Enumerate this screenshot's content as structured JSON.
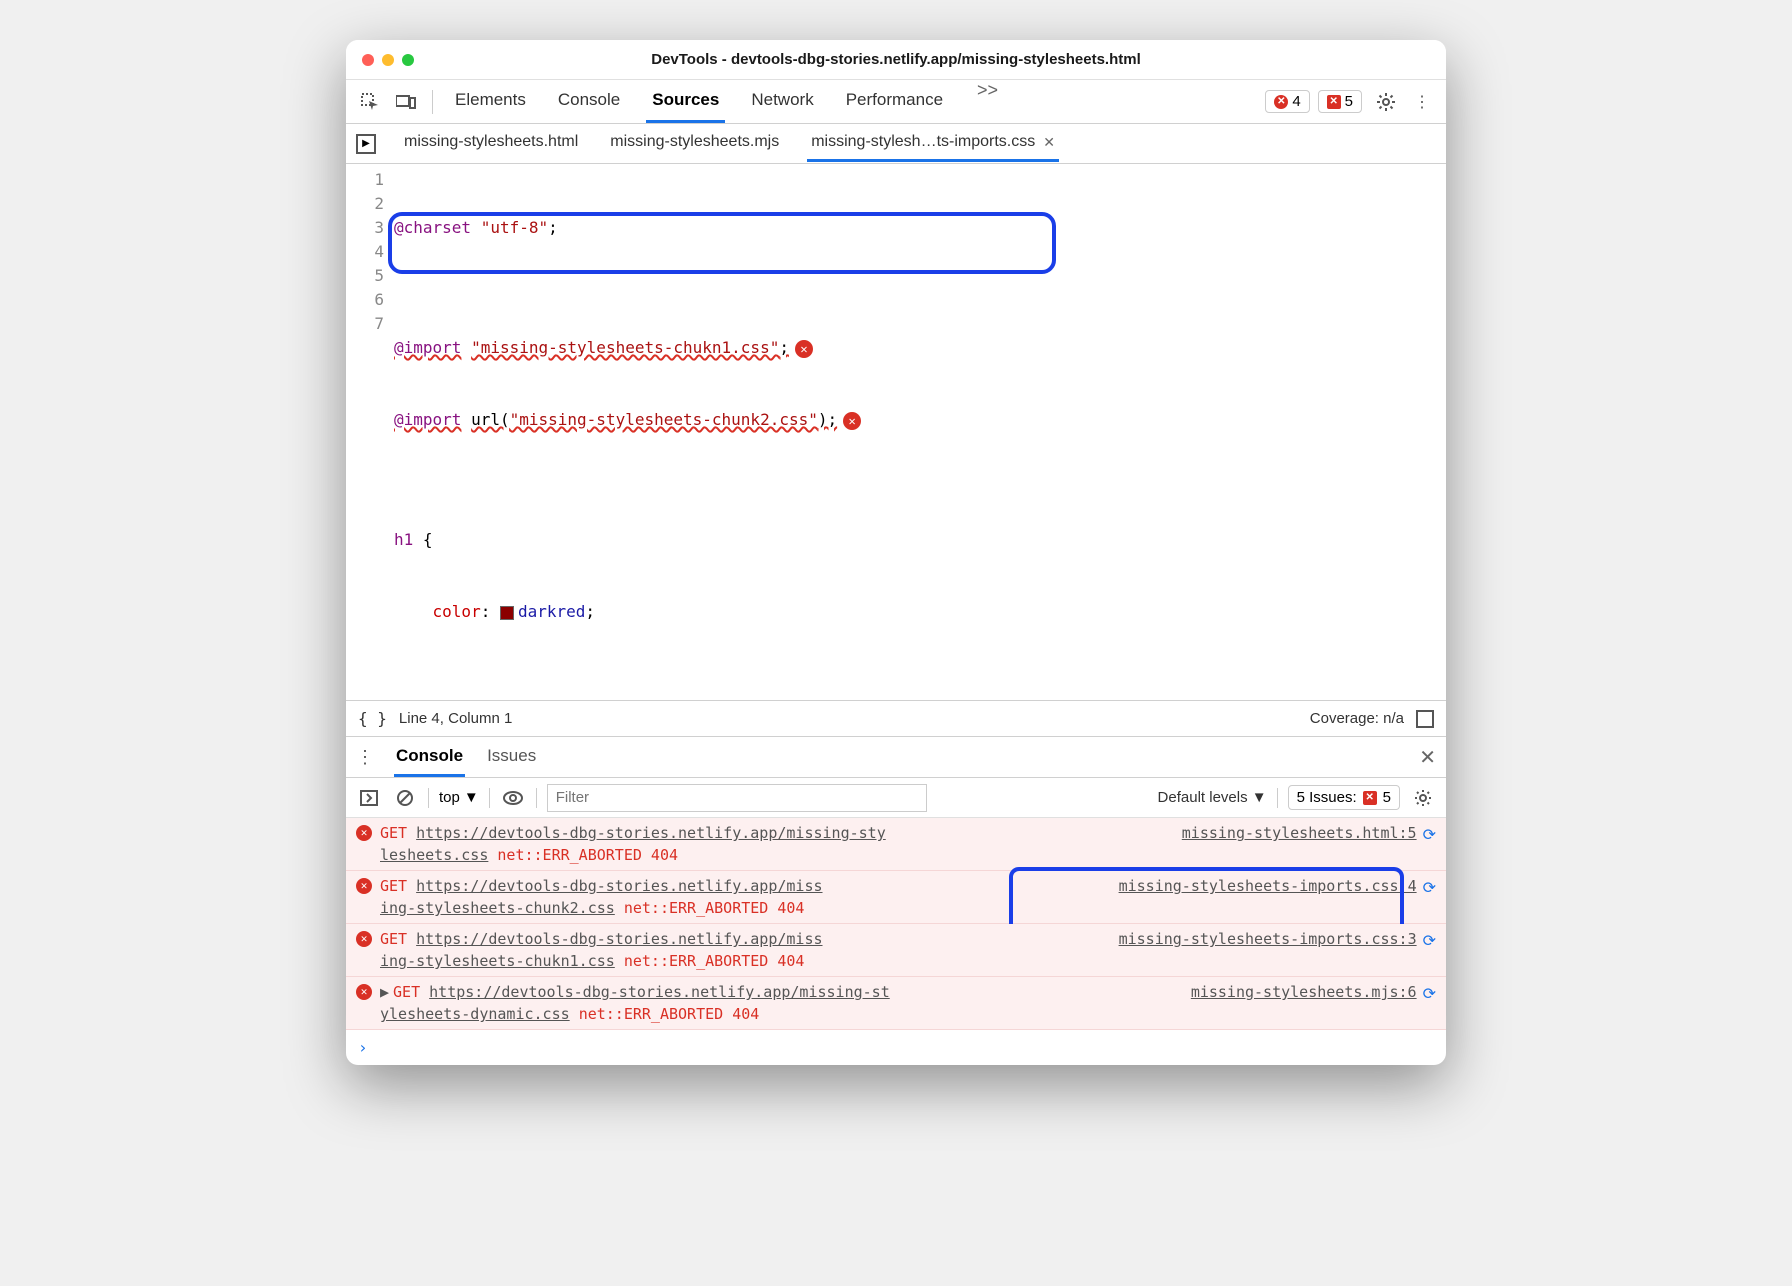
{
  "window": {
    "title": "DevTools - devtools-dbg-stories.netlify.app/missing-stylesheets.html"
  },
  "panels": {
    "items": [
      "Elements",
      "Console",
      "Sources",
      "Network",
      "Performance"
    ],
    "active": "Sources",
    "overflow": ">>"
  },
  "badges": {
    "errors": "4",
    "issues": "5"
  },
  "file_tabs": {
    "items": [
      {
        "label": "missing-stylesheets.html"
      },
      {
        "label": "missing-stylesheets.mjs"
      },
      {
        "label": "missing-stylesh…ts-imports.css",
        "active": true
      }
    ]
  },
  "editor": {
    "lines": [
      {
        "n": "1",
        "html": "<span class='kw'>@charset</span> <span class='str'>\"utf-8\"</span>;"
      },
      {
        "n": "2",
        "html": ""
      },
      {
        "n": "3",
        "html": "<span class='kw wavy'>@import</span> <span class='str wavy'>\"missing-stylesheets-chukn1.css\"</span><span class='wavy'>;</span><span class='inline-err'>✕</span>",
        "err": true
      },
      {
        "n": "4",
        "html": "<span class='kw wavy'>@import</span> <span class='wavy'>url(</span><span class='str wavy'>\"missing-stylesheets-chunk2.css\"</span><span class='wavy'>);</span><span class='inline-err'>✕</span>",
        "err": true
      },
      {
        "n": "5",
        "html": ""
      },
      {
        "n": "6",
        "html": "<span class='sel'>h1</span> {"
      },
      {
        "n": "7",
        "html": "    <span class='prop'>color</span>: <span class='swatch'></span><span class='val'>darkred</span>;"
      }
    ]
  },
  "statusbar": {
    "cursor": "Line 4, Column 1",
    "coverage": "Coverage: n/a"
  },
  "drawer": {
    "tabs": [
      "Console",
      "Issues"
    ],
    "active": "Console"
  },
  "console_toolbar": {
    "context": "top",
    "filter_placeholder": "Filter",
    "levels": "Default levels",
    "issues_label": "5 Issues:",
    "issues_count": "5"
  },
  "console": {
    "rows": [
      {
        "get": "GET",
        "url_pt1": "https://devtools-dbg-stories.netlify.app/missing-sty",
        "url_pt2": "lesheets.css",
        "err": "net::ERR_ABORTED 404",
        "src": "missing-stylesheets.html:5"
      },
      {
        "get": "GET",
        "url_pt1": "https://devtools-dbg-stories.netlify.app/miss",
        "url_pt2": "ing-stylesheets-chunk2.css",
        "err": "net::ERR_ABORTED 404",
        "src": "missing-stylesheets-imports.css:4"
      },
      {
        "get": "GET",
        "url_pt1": "https://devtools-dbg-stories.netlify.app/miss",
        "url_pt2": "ing-stylesheets-chukn1.css",
        "err": "net::ERR_ABORTED 404",
        "src": "missing-stylesheets-imports.css:3"
      },
      {
        "get": "GET",
        "expand": "▶",
        "url_pt1": "https://devtools-dbg-stories.netlify.app/missing-st",
        "url_pt2": "ylesheets-dynamic.css",
        "err": "net::ERR_ABORTED 404",
        "src": "missing-stylesheets.mjs:6"
      }
    ]
  }
}
